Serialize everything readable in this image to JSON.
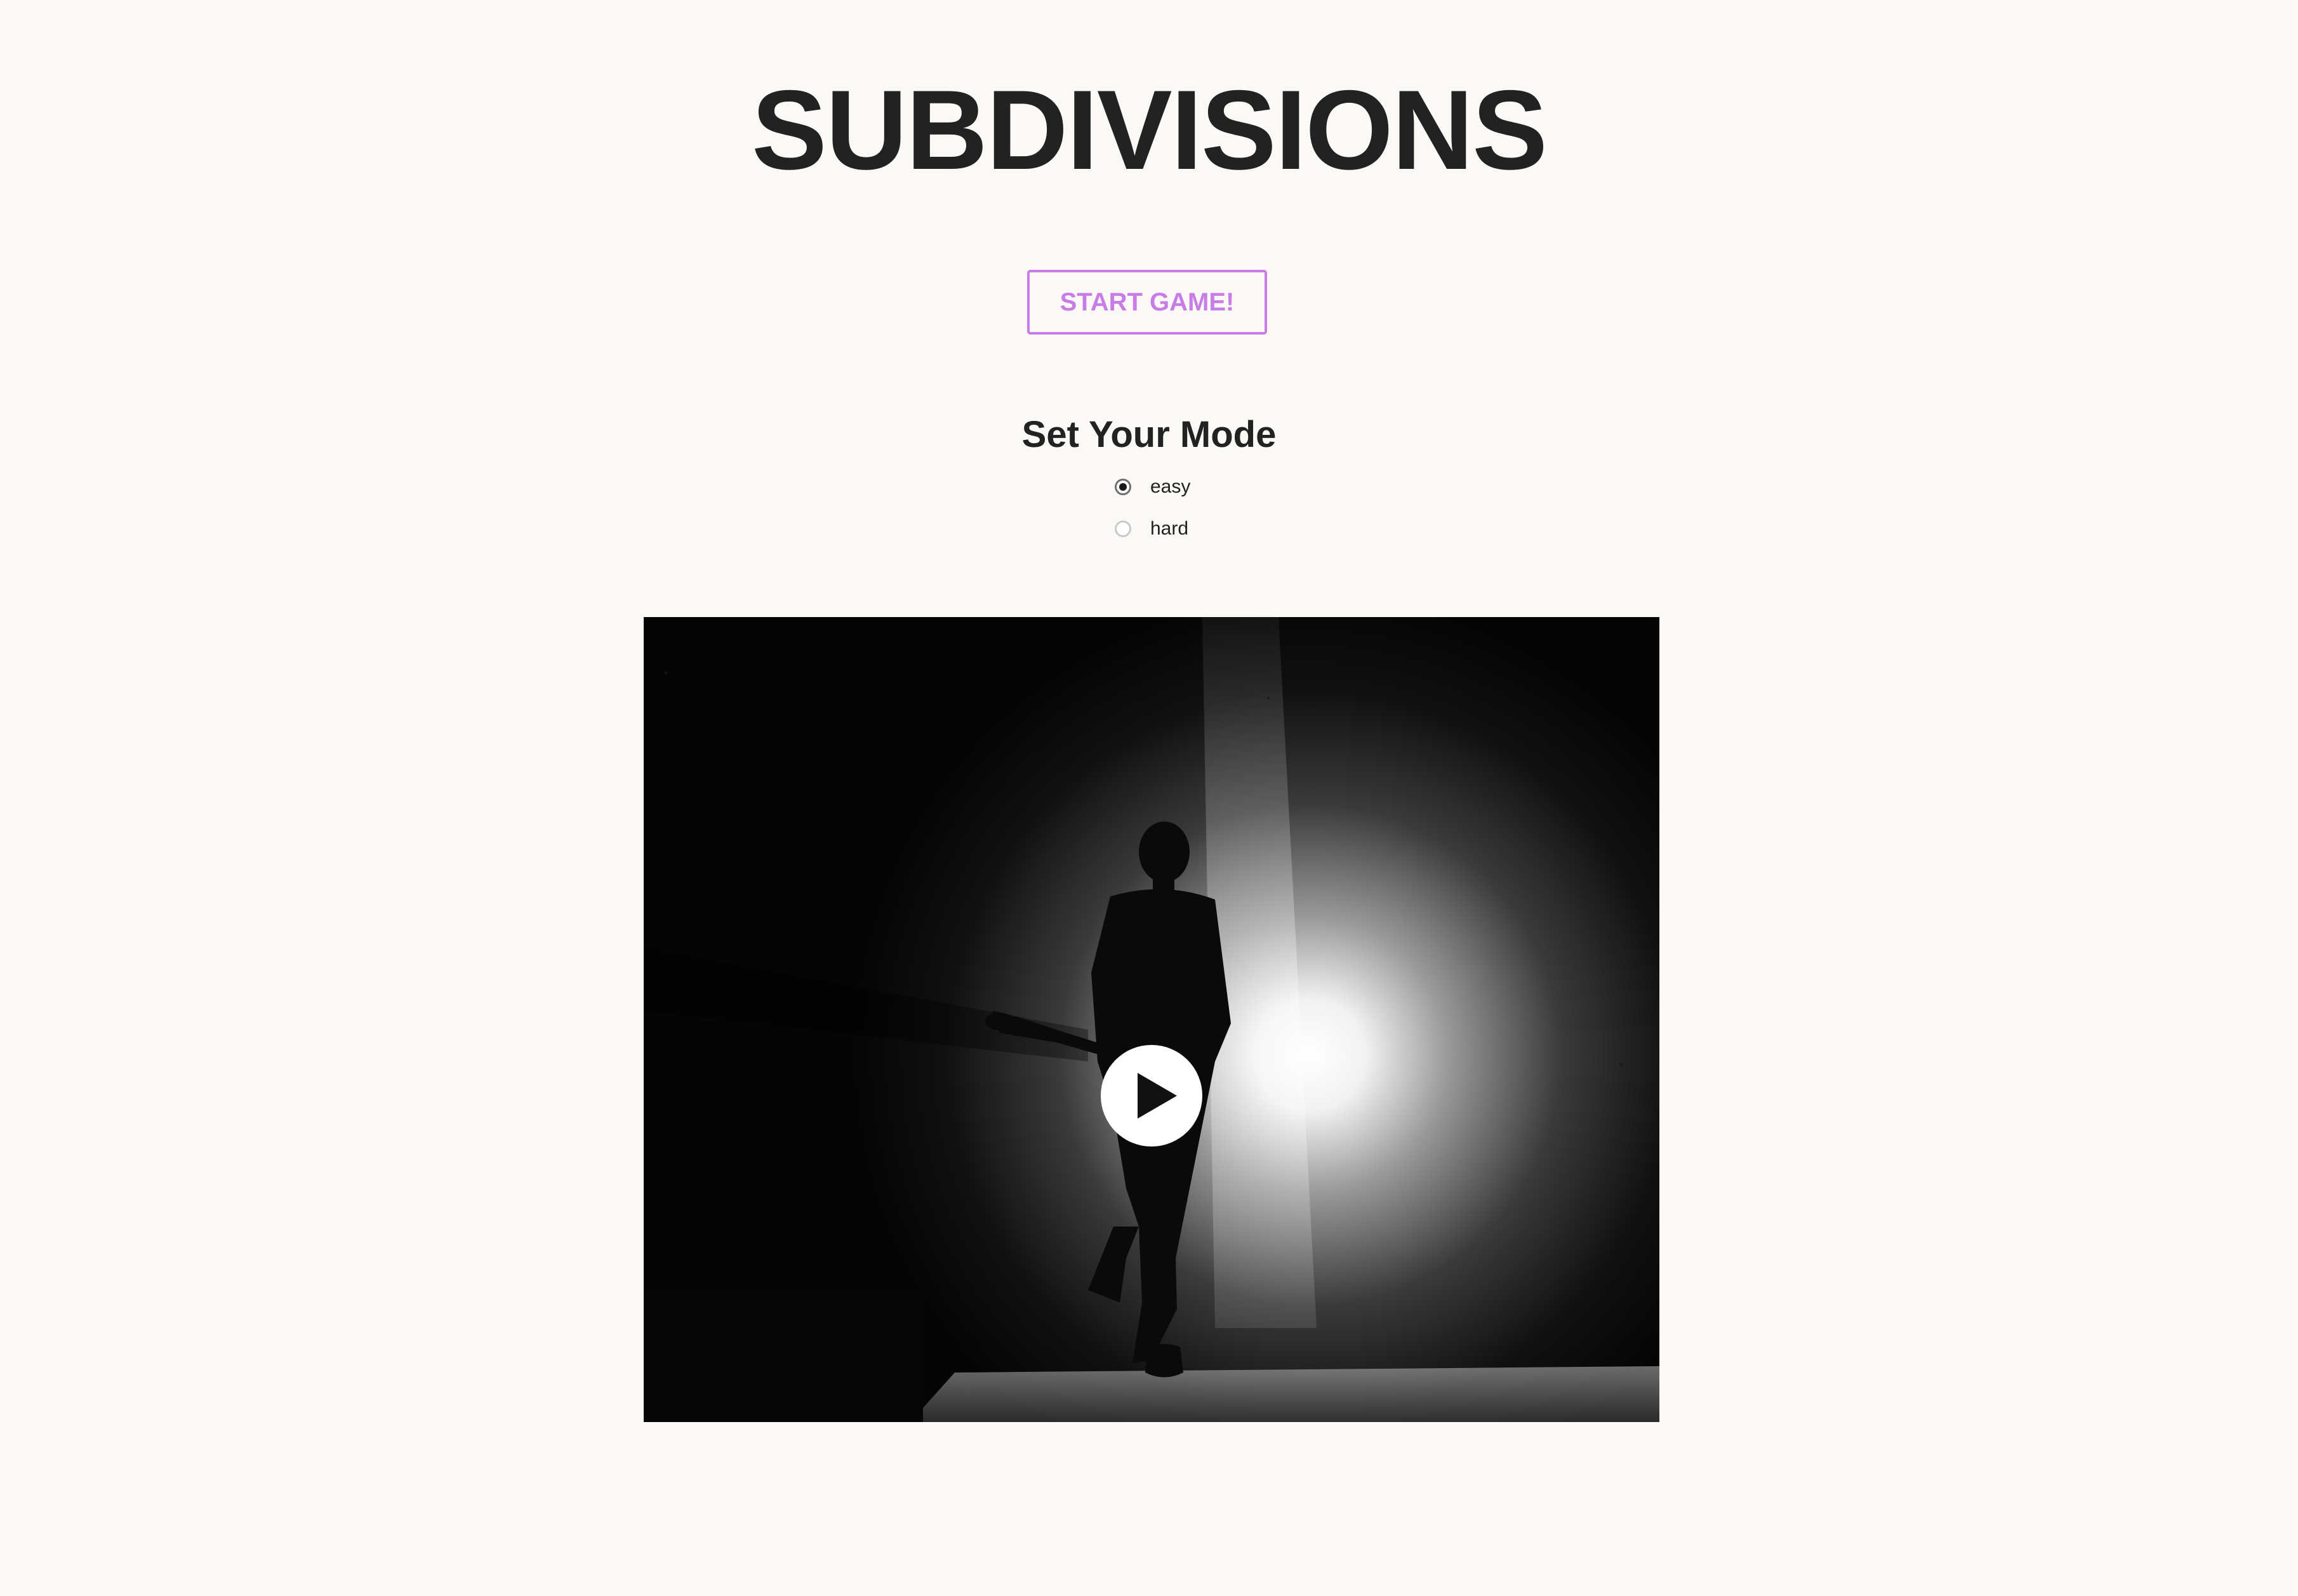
{
  "page": {
    "title": "SUBDIVISIONS",
    "start_button_label": "START GAME!",
    "mode_section": {
      "heading": "Set Your Mode",
      "options": [
        {
          "label": "easy",
          "selected": true
        },
        {
          "label": "hard",
          "selected": false
        }
      ]
    },
    "video": {
      "play_icon": "play-icon",
      "state": "paused"
    }
  },
  "colors": {
    "background": "#faf9f5",
    "text": "#222222",
    "accent": "#c77ce8"
  }
}
